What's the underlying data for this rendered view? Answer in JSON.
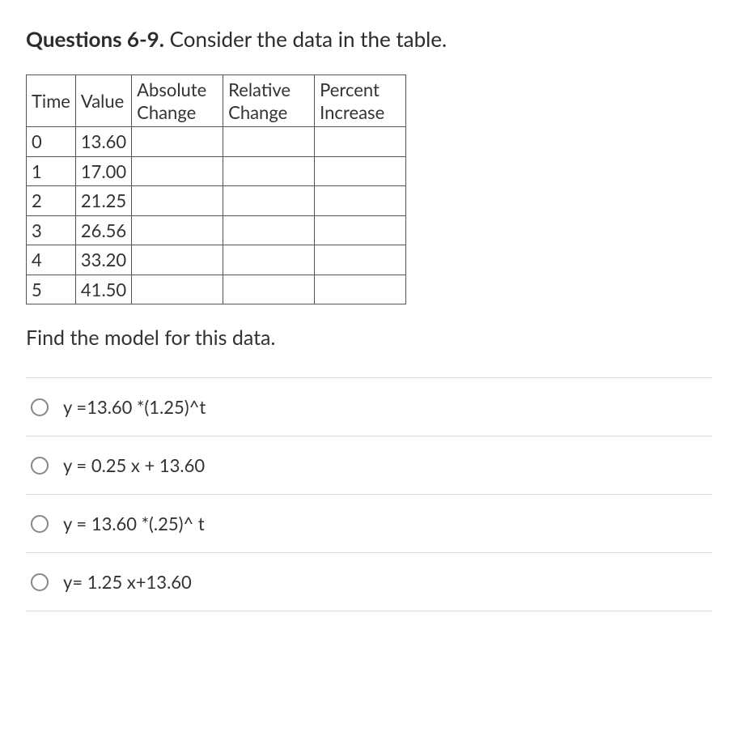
{
  "heading_bold": "Questions 6-9.",
  "heading_rest": " Consider the data in the table.",
  "table": {
    "headers": [
      "Time",
      "Value",
      "Absolute Change",
      "Relative Change",
      "Percent Increase"
    ],
    "rows": [
      {
        "time": "0",
        "value": "13.60",
        "abs": "",
        "rel": "",
        "pct": ""
      },
      {
        "time": "1",
        "value": "17.00",
        "abs": "",
        "rel": "",
        "pct": ""
      },
      {
        "time": "2",
        "value": "21.25",
        "abs": "",
        "rel": "",
        "pct": ""
      },
      {
        "time": "3",
        "value": "26.56",
        "abs": "",
        "rel": "",
        "pct": ""
      },
      {
        "time": "4",
        "value": "33.20",
        "abs": "",
        "rel": "",
        "pct": ""
      },
      {
        "time": "5",
        "value": "41.50",
        "abs": "",
        "rel": "",
        "pct": ""
      }
    ]
  },
  "prompt": "Find the model for this data.",
  "options": [
    "y =13.60 *(1.25)^t",
    "y = 0.25 x + 13.60",
    "y = 13.60 *(.25)^ t",
    "y= 1.25 x+13.60"
  ]
}
